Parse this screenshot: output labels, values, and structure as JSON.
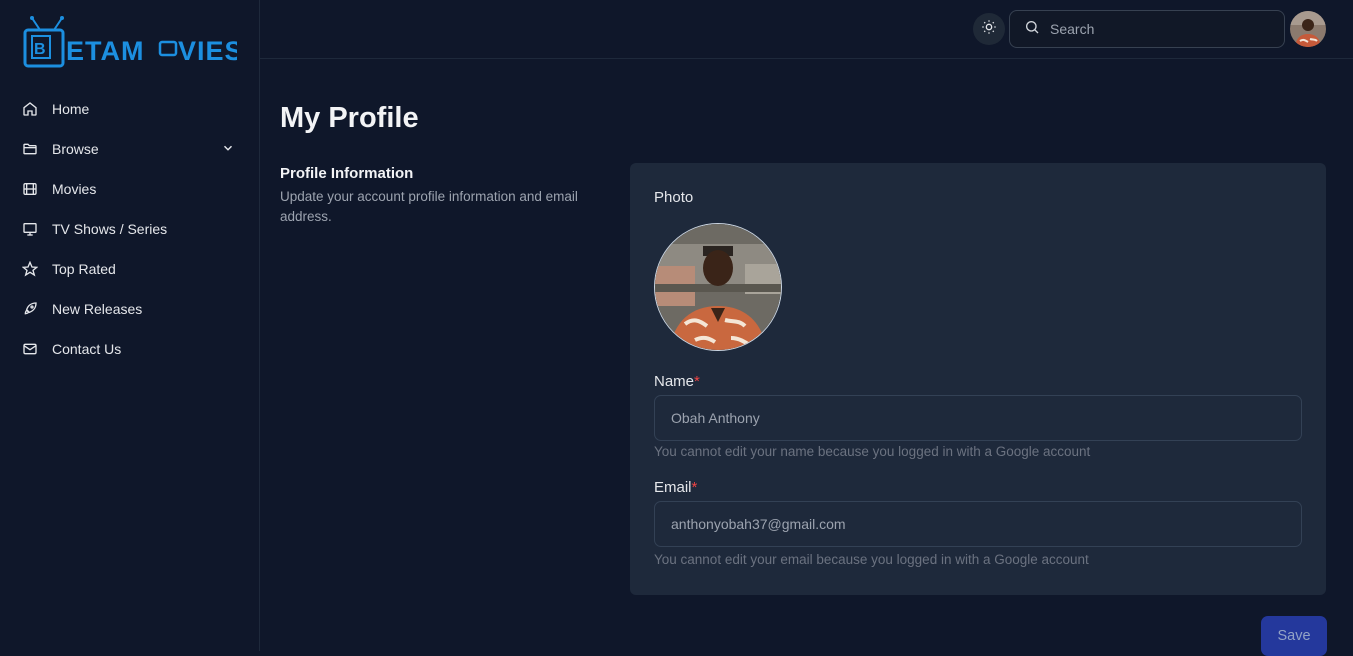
{
  "brand": {
    "logo_text": "BetaMovies",
    "accent": "#1c8fe0"
  },
  "sidebar": {
    "items": [
      {
        "label": "Home",
        "icon": "home-icon"
      },
      {
        "label": "Browse",
        "icon": "folder-icon",
        "has_submenu": true
      },
      {
        "label": "Movies",
        "icon": "film-icon"
      },
      {
        "label": "TV Shows / Series",
        "icon": "tv-icon"
      },
      {
        "label": "Top Rated",
        "icon": "star-icon"
      },
      {
        "label": "New Releases",
        "icon": "rocket-icon"
      },
      {
        "label": "Contact Us",
        "icon": "mail-icon"
      }
    ]
  },
  "header": {
    "search_placeholder": "Search",
    "theme_toggle_icon": "sun-icon"
  },
  "main": {
    "title": "My Profile",
    "section": {
      "title": "Profile Information",
      "description": "Update your account profile information and email address."
    },
    "form": {
      "photo_label": "Photo",
      "name_label": "Name",
      "name_required": "*",
      "name_value": "Obah Anthony",
      "name_help": "You cannot edit your name because you logged in with a Google account",
      "email_label": "Email",
      "email_required": "*",
      "email_value": "anthonyobah37@gmail.com",
      "email_help": "You cannot edit your email because you logged in with a Google account",
      "save_label": "Save"
    }
  },
  "colors": {
    "background": "#0f172a",
    "card": "#1e293b",
    "required": "#ef4444",
    "save_button": "#24389c"
  }
}
